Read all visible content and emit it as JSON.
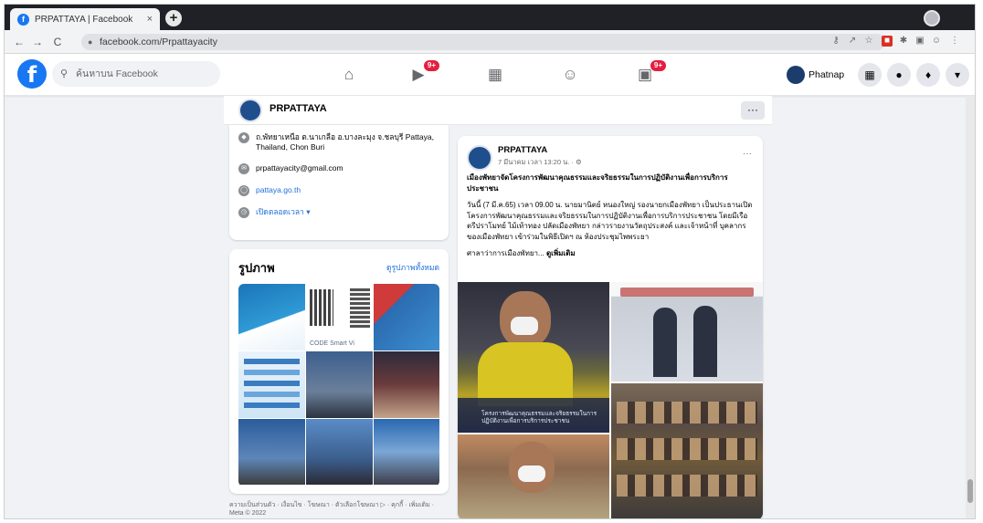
{
  "browser": {
    "tab_title": "PRPATTAYA | Facebook",
    "tab_close": "×",
    "new_tab": "+",
    "url": "facebook.com/Prpattayacity",
    "back": "←",
    "forward": "→",
    "reload": "C"
  },
  "fb": {
    "logo": "f",
    "search_placeholder": "ค้นหาบน Facebook",
    "nav": [
      {
        "icon": "home-icon",
        "glyph": "⌂"
      },
      {
        "icon": "watch-icon",
        "glyph": "▶",
        "badge": "9+"
      },
      {
        "icon": "marketplace-icon",
        "glyph": "▦"
      },
      {
        "icon": "groups-icon",
        "glyph": "☺"
      },
      {
        "icon": "gaming-icon",
        "glyph": "▣",
        "badge": "9+"
      }
    ],
    "user_name": "Phatnap",
    "menu_glyph": "⁝⁝⁝",
    "messenger_glyph": "●",
    "notif_glyph": "♦",
    "account_glyph": "▾"
  },
  "page": {
    "name": "PRPATTAYA",
    "more": "···"
  },
  "intro": {
    "address": "ถ.พัทยาเหนือ ต.นาเกลือ อ.บางละมุง จ.ชลบุรี Pattaya, Thailand, Chon Buri",
    "email": "prpattayacity@gmail.com",
    "website": "pattaya.go.th",
    "hours": "เปิดตลอดเวลา ▾"
  },
  "photos": {
    "title": "รูปภาพ",
    "see_all": "ดูรูปภาพทั้งหมด",
    "smart_text": "CODE Smart Vi"
  },
  "footer": "ความเป็นส่วนตัว · เงื่อนไข · โฆษณา · ตัวเลือกโฆษณา ▷ · คุกกี้ · เพิ่มเติม · Meta © 2022",
  "post": {
    "author": "PRPATTAYA",
    "time": "7 มีนาคม เวลา 13:20 น. · ⚙",
    "more": "···",
    "headline": "เมืองพัทยาจัดโครงการพัฒนาคุณธรรมและจริยธรรมในการปฏิบัติงานเพื่อการบริการประชาชน",
    "body": "วันนี้ (7 มี.ค.65) เวลา 09.00 น. นายมานิตย์ หนองใหญ่ รองนายกเมืองพัทยา เป็นประธานเปิดโครงการพัฒนาคุณธรรมและจริยธรรมในการปฏิบัติงานเพื่อการบริการประชาชน โดยมีเรือตรีปราโมทย์ ไม้เท้าทอง ปลัดเมืองพัทยา กล่าวรายงานวัตถุประสงค์ และเจ้าหน้าที่ บุคลากรของเมืองพัทยา เข้าร่วมในพิธีเปิดฯ ณ ห้องประชุมไพพระยา",
    "location": "ศาลาว่าการเมืองพัทยา...",
    "see_more": "ดูเพิ่มเติม",
    "image_caption": "โครงการพัฒนาคุณธรรมและจริยธรรมในการปฏิบัติงานเพื่อการบริการประชาชน"
  }
}
